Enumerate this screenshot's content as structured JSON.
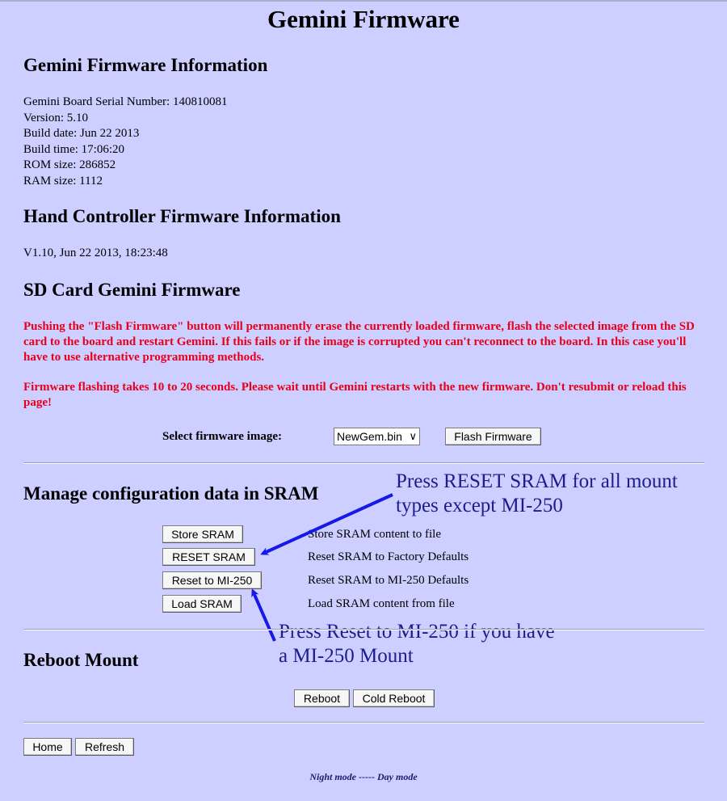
{
  "page": {
    "title": "Gemini Firmware"
  },
  "gemini_info": {
    "heading": "Gemini Firmware Information",
    "serial": "Gemini Board Serial Number: 140810081",
    "version": "Version: 5.10",
    "build_date": "Build date: Jun 22 2013",
    "build_time": "Build time: 17:06:20",
    "rom_size": "ROM size: 286852",
    "ram_size": "RAM size: 1112"
  },
  "hand_controller": {
    "heading": "Hand Controller Firmware Information",
    "value": "V1.10, Jun 22 2013, 18:23:48"
  },
  "sd_card": {
    "heading": "SD Card Gemini Firmware",
    "warning1": "Pushing the \"Flash Firmware\" button will permanently erase the currently loaded firmware, flash the selected image from the SD card to the board and restart Gemini. If this fails or if the image is corrupted you can't reconnect to the board. In this case you'll have to use alternative programming methods.",
    "warning2": "Firmware flashing takes 10 to 20 seconds. Please wait until Gemini restarts with the new firmware. Don't resubmit or reload this page!",
    "select_label": "Select firmware image:",
    "select_value": "NewGem.bin",
    "flash_button": "Flash Firmware"
  },
  "sram": {
    "heading": "Manage configuration data in SRAM",
    "rows": [
      {
        "button": "Store SRAM",
        "desc": "Store SRAM content to file"
      },
      {
        "button": "RESET SRAM",
        "desc": "Reset SRAM to Factory Defaults"
      },
      {
        "button": "Reset to MI-250",
        "desc": "Reset SRAM to MI-250 Defaults"
      },
      {
        "button": "Load SRAM",
        "desc": "Load SRAM content from file"
      }
    ]
  },
  "annotations": {
    "reset_note_line1": "Press RESET SRAM for all mount",
    "reset_note_line2": "types except MI-250",
    "mi250_note_line1": "Press Reset to MI-250 if you have",
    "mi250_note_line2": "a MI-250 Mount",
    "color": "#1818e8"
  },
  "reboot": {
    "heading": "Reboot Mount",
    "reboot_button": "Reboot",
    "cold_reboot_button": "Cold Reboot"
  },
  "nav": {
    "home_button": "Home",
    "refresh_button": "Refresh"
  },
  "footer": {
    "night_mode": "Night mode",
    "separator": "-----",
    "day_mode": "Day mode"
  },
  "colors": {
    "background": "#cccfff",
    "warning_text": "#e8001a",
    "annotation_text": "#1c1c8c"
  }
}
